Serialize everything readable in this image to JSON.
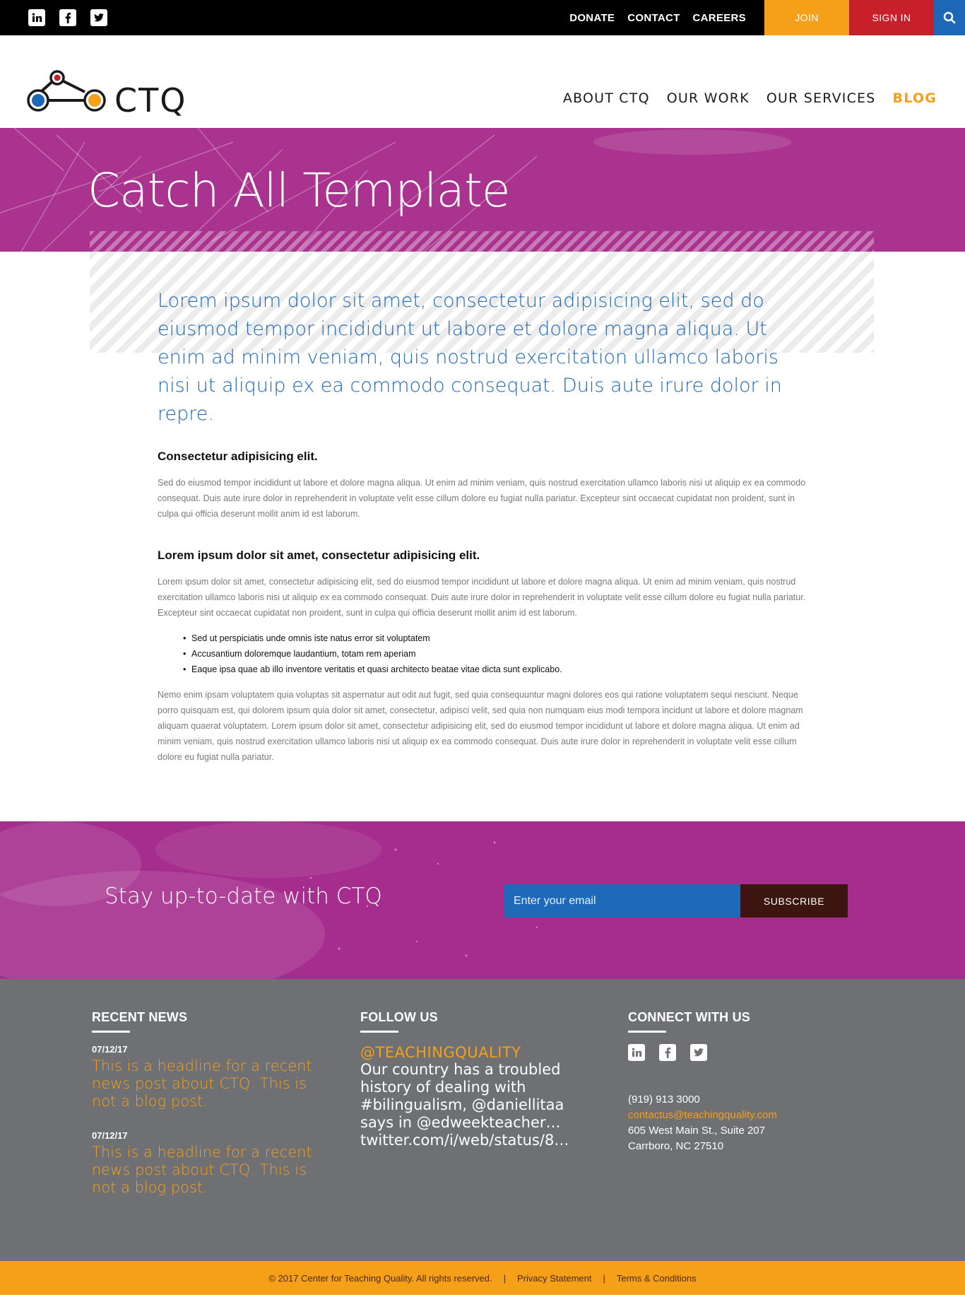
{
  "topbar": {
    "links": [
      "DONATE",
      "CONTACT",
      "CAREERS"
    ],
    "join_label": "JOIN",
    "signin_label": "SIGN IN"
  },
  "brand": {
    "logo_text": "CTQ"
  },
  "nav": {
    "items": [
      "ABOUT CTQ",
      "OUR WORK",
      "OUR SERVICES",
      "BLOG"
    ],
    "active": "BLOG"
  },
  "hero": {
    "title": "Catch All Template"
  },
  "content": {
    "lead": "Lorem ipsum dolor sit amet, consectetur adipisicing elit, sed do eiusmod tempor incididunt ut labore et dolore magna aliqua. Ut enim ad minim veniam, quis nostrud exercitation ullamco laboris nisi ut aliquip ex ea commodo consequat. Duis aute irure dolor in repre.",
    "heading1": "Consectetur adipisicing elit.",
    "para1": "Sed do eiusmod tempor incididunt ut labore et dolore magna aliqua. Ut enim ad minim veniam, quis nostrud exercitation ullamco laboris nisi ut aliquip ex ea commodo consequat. Duis aute irure dolor in reprehenderit in voluptate velit esse cillum dolore eu fugiat nulla pariatur. Excepteur sint occaecat cupidatat non proident, sunt in culpa qui officia deserunt mollit anim id est laborum.",
    "heading2": "Lorem ipsum dolor sit amet, consectetur adipisicing elit.",
    "para2": "Lorem ipsum dolor sit amet, consectetur adipisicing elit, sed do eiusmod tempor incididunt ut labore et dolore magna aliqua. Ut enim ad minim veniam, quis nostrud exercitation ullamco laboris nisi ut aliquip ex ea commodo consequat. Duis aute irure dolor in reprehenderit in voluptate velit esse cillum dolore eu fugiat nulla pariatur. Excepteur sint occaecat cupidatat non proident, sunt in culpa qui officia deserunt mollit anim id est laborum.",
    "bullets": [
      "Sed ut perspiciatis unde omnis iste natus error sit voluptatem",
      "Accusantium doloremque laudantium, totam rem aperiam",
      "Eaque ipsa quae ab illo inventore veritatis et quasi architecto beatae vitae dicta sunt explicabo."
    ],
    "para3": "Nemo enim ipsam voluptatem quia voluptas sit aspernatur aut odit aut fugit, sed quia consequuntur magni dolores eos qui ratione voluptatem sequi nesciunt. Neque porro quisquam est, qui dolorem ipsum quia dolor sit amet, consectetur, adipisci velit, sed quia non numquam eius modi tempora incidunt ut labore et dolore magnam aliquam quaerat voluptatem. Lorem ipsum dolor sit amet, consectetur adipisicing elit, sed do eiusmod tempor incididunt ut labore et dolore magna aliqua. Ut enim ad minim veniam, quis nostrud exercitation ullamco laboris nisi ut aliquip ex ea commodo consequat. Duis aute irure dolor in reprehenderit in voluptate velit esse cillum dolore eu fugiat nulla pariatur."
  },
  "subscribe": {
    "text": "Stay up-to-date with CTQ",
    "email_placeholder": "Enter your email",
    "button_label": "SUBSCRIBE"
  },
  "footer": {
    "recent_news": {
      "heading": "RECENT NEWS",
      "items": [
        {
          "date": "07/12/17",
          "headline": "This is a headline for a recent news post about CTQ. This is not a blog post."
        },
        {
          "date": "07/12/17",
          "headline": "This is a headline for a recent news post about CTQ. This is not a blog post."
        }
      ]
    },
    "follow_us": {
      "heading": "FOLLOW US",
      "handle": "@TEACHINGQUALITY",
      "tweet": "Our country has a troubled history of dealing with #bilingualism, @daniellitaa says in @edweekteacher… twitter.com/i/web/status/8…"
    },
    "connect": {
      "heading": "CONNECT WITH US",
      "phone": "(919) 913 3000",
      "email": "contactus@teachingquality.com",
      "address1": "605 West Main St., Suite 207",
      "address2": "Carrboro, NC 27510"
    }
  },
  "bottombar": {
    "copyright": "© 2017 Center for Teaching Quality. All rights reserved.",
    "separator": "|",
    "privacy": "Privacy Statement",
    "terms": "Terms & Conditions"
  },
  "icons": {
    "social": [
      "linkedin-icon",
      "facebook-icon",
      "twitter-icon"
    ],
    "search": "search-icon"
  },
  "colors": {
    "accent_orange": "#f6a01a",
    "signin_red": "#c8202a",
    "brand_blue": "#1d67b7",
    "hero_magenta": "#a9338e",
    "footer_gray": "#6f7073",
    "subscribe_dark": "#3d1510"
  }
}
